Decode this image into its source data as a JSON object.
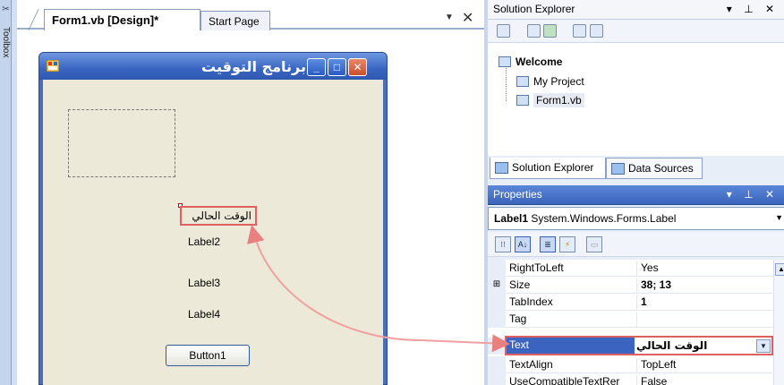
{
  "toolbox": {
    "label": "Toolbox"
  },
  "designer": {
    "tabs": [
      {
        "label": "Form1.vb [Design]*"
      },
      {
        "label": "Start Page"
      }
    ],
    "tab_dropdown": "▼",
    "tab_close": "✕"
  },
  "form": {
    "title": "برنامج التوقيت",
    "min_glyph": "_",
    "max_glyph": "□",
    "close_glyph": "✕",
    "labels": {
      "label1": "الوقت الحالي",
      "label2": "Label2",
      "label3": "Label3",
      "label4": "Label4"
    },
    "button1": "Button1"
  },
  "solution_explorer": {
    "title": "Solution Explorer",
    "controls": "▾ ᛫ ✕",
    "tree": {
      "root": "Welcome",
      "project": "My Project",
      "form": "Form1.vb"
    },
    "tabs": [
      {
        "label": "Solution Explorer"
      },
      {
        "label": "Data Sources"
      }
    ]
  },
  "properties": {
    "title": "Properties",
    "controls": "▾ ᛫ ✕",
    "object_name": "Label1",
    "object_type": "System.Windows.Forms.Label",
    "rows": [
      {
        "name": "RightToLeft",
        "value": "Yes",
        "expander": "",
        "bold": false
      },
      {
        "name": "Size",
        "value": "38; 13",
        "expander": "⊞",
        "bold": true
      },
      {
        "name": "TabIndex",
        "value": "1",
        "expander": "",
        "bold": true
      },
      {
        "name": "Tag",
        "value": "",
        "expander": "",
        "bold": false
      },
      {
        "name": "Text",
        "value": "الوقت الحالي",
        "expander": "",
        "bold": true
      },
      {
        "name": "TextAlign",
        "value": "TopLeft",
        "expander": "",
        "bold": false
      },
      {
        "name": "UseCompatibleTextRer",
        "value": "False",
        "expander": "",
        "bold": false
      }
    ]
  },
  "colors": {
    "accent_red": "#e06060",
    "title_blue": "#3a64c0",
    "form_bg": "#ece9d8"
  }
}
